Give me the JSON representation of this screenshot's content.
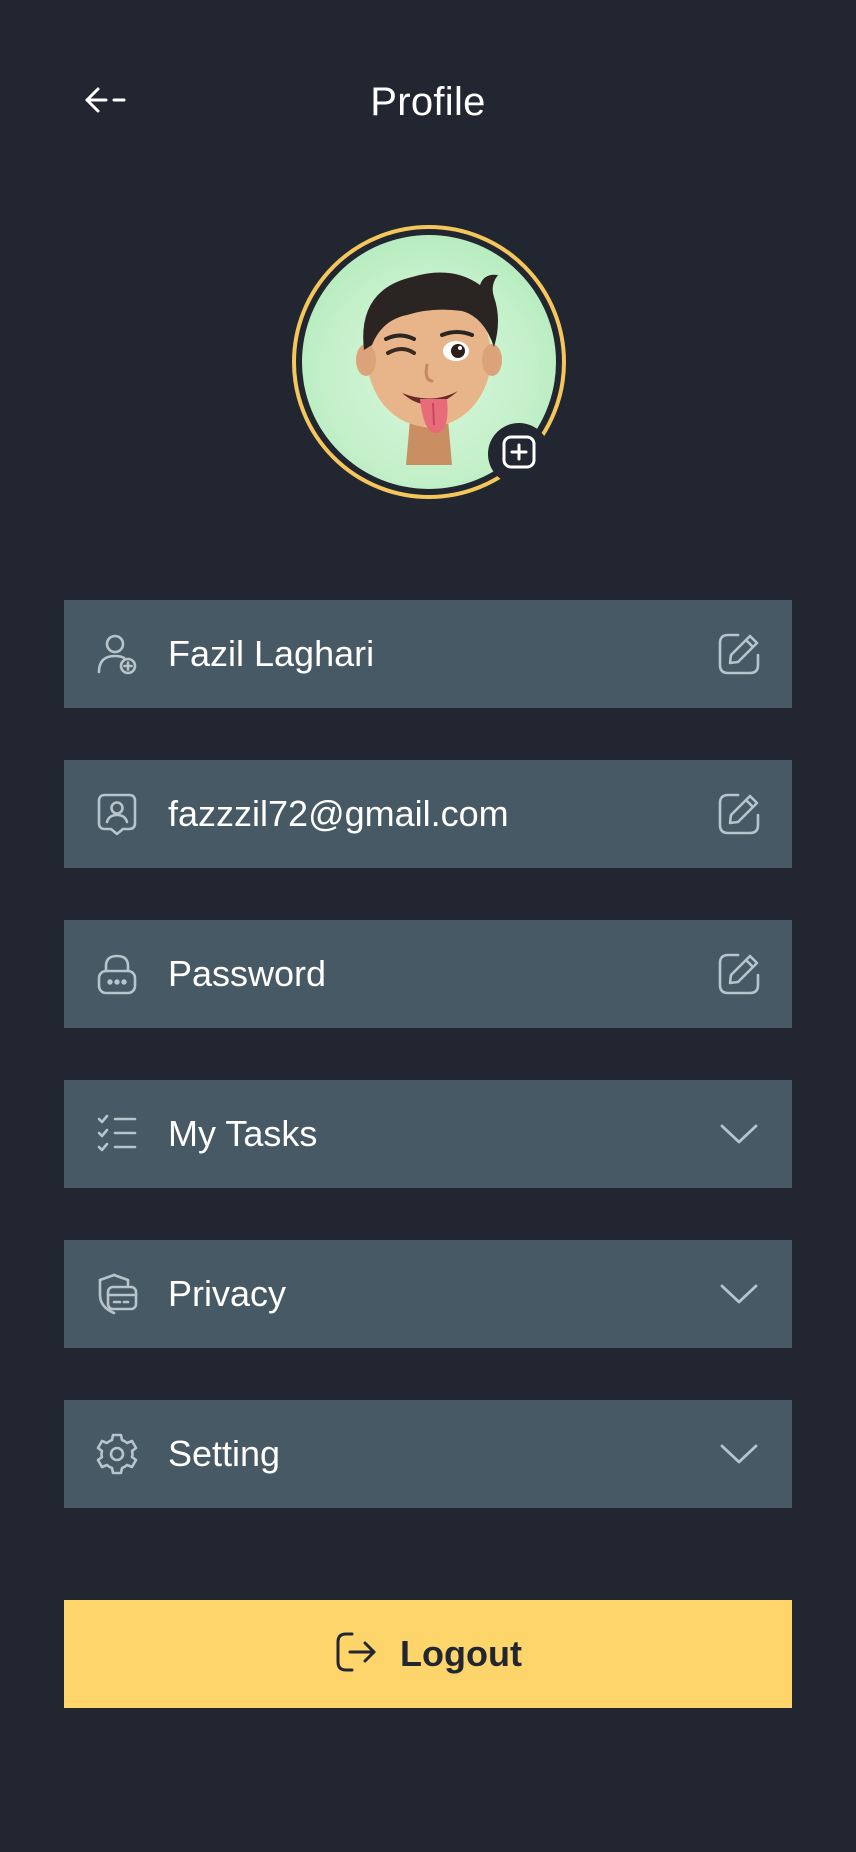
{
  "header": {
    "title": "Profile",
    "back_icon": "arrow-left-icon"
  },
  "profile": {
    "avatar": "memoji-avatar",
    "add_photo_icon": "plus-square-icon"
  },
  "fields": [
    {
      "label": "Fazil Laghari",
      "icon": "user-add-icon",
      "action_icon": "edit-icon"
    },
    {
      "label": "fazzzil72@gmail.com",
      "icon": "contact-card-icon",
      "action_icon": "edit-icon"
    },
    {
      "label": "Password",
      "icon": "lock-icon",
      "action_icon": "edit-icon"
    }
  ],
  "menu": [
    {
      "label": "My Tasks",
      "icon": "task-list-icon",
      "action_icon": "chevron-down-icon"
    },
    {
      "label": "Privacy",
      "icon": "privacy-shield-icon",
      "action_icon": "chevron-down-icon"
    },
    {
      "label": "Setting",
      "icon": "gear-icon",
      "action_icon": "chevron-down-icon"
    }
  ],
  "logout": {
    "label": "Logout",
    "icon": "logout-icon"
  },
  "colors": {
    "background": "#212631",
    "row": "#475965",
    "accent": "#fed56b",
    "avatar_ring": "#f5c75a",
    "icon": "#b8c4cc"
  }
}
